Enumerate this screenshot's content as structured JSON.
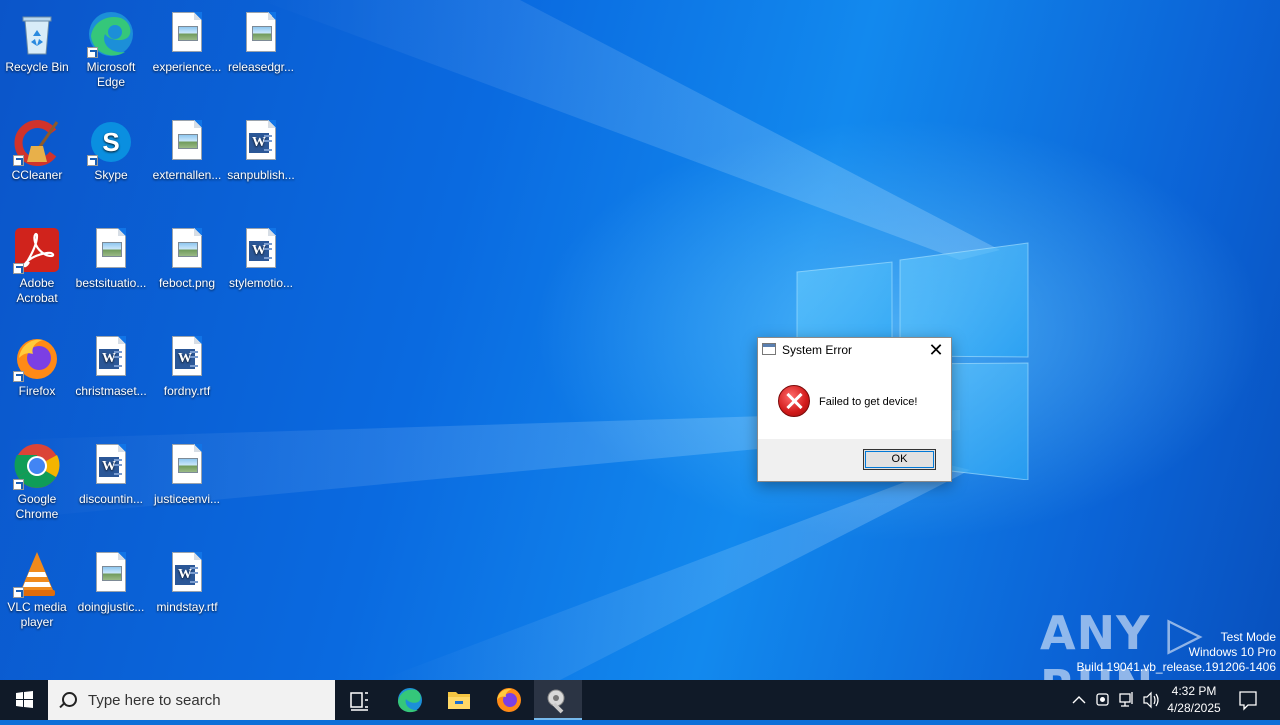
{
  "desktop": {
    "icons": [
      {
        "label": "Recycle Bin",
        "icon": "recycle-bin-icon"
      },
      {
        "label": "Microsoft Edge",
        "icon": "edge-icon"
      },
      {
        "label": "experience...",
        "icon": "image-file-icon"
      },
      {
        "label": "releasedgr...",
        "icon": "image-file-icon"
      },
      {
        "label": "CCleaner",
        "icon": "ccleaner-icon"
      },
      {
        "label": "Skype",
        "icon": "skype-icon"
      },
      {
        "label": "externallen...",
        "icon": "image-file-icon"
      },
      {
        "label": "sanpublish...",
        "icon": "word-file-icon"
      },
      {
        "label": "Adobe Acrobat",
        "icon": "acrobat-icon"
      },
      {
        "label": "bestsituatio...",
        "icon": "image-file-icon"
      },
      {
        "label": "feboct.png",
        "icon": "image-file-icon"
      },
      {
        "label": "stylemotio...",
        "icon": "word-file-icon"
      },
      {
        "label": "Firefox",
        "icon": "firefox-icon"
      },
      {
        "label": "christmaset...",
        "icon": "word-file-icon"
      },
      {
        "label": "fordny.rtf",
        "icon": "word-file-icon"
      },
      {
        "label": "Google Chrome",
        "icon": "chrome-icon"
      },
      {
        "label": "discountin...",
        "icon": "word-file-icon"
      },
      {
        "label": "justiceenvi...",
        "icon": "image-file-icon"
      },
      {
        "label": "VLC media player",
        "icon": "vlc-icon"
      },
      {
        "label": "doingjustic...",
        "icon": "image-file-icon"
      },
      {
        "label": "mindstay.rtf",
        "icon": "word-file-icon"
      }
    ]
  },
  "dialog": {
    "title": "System Error",
    "close_glyph": "✕",
    "message": "Failed to get device!",
    "ok_label": "OK"
  },
  "watermark": {
    "brand": "ANY ▷ RUN",
    "line1": "Test Mode",
    "line2": "Windows 10 Pro",
    "line3": "Build 19041.vb_release.191206-1406"
  },
  "taskbar": {
    "search_placeholder": "Type here to search",
    "apps": [
      "task-view-icon",
      "edge-icon",
      "file-explorer-icon",
      "firefox-icon",
      "running-app-icon"
    ],
    "clock_time": "4:32 PM",
    "clock_date": "4/28/2025"
  },
  "colors": {
    "taskbar_bg": "#101a28",
    "accent": "#0078d7",
    "error_red": "#d11a1a"
  }
}
